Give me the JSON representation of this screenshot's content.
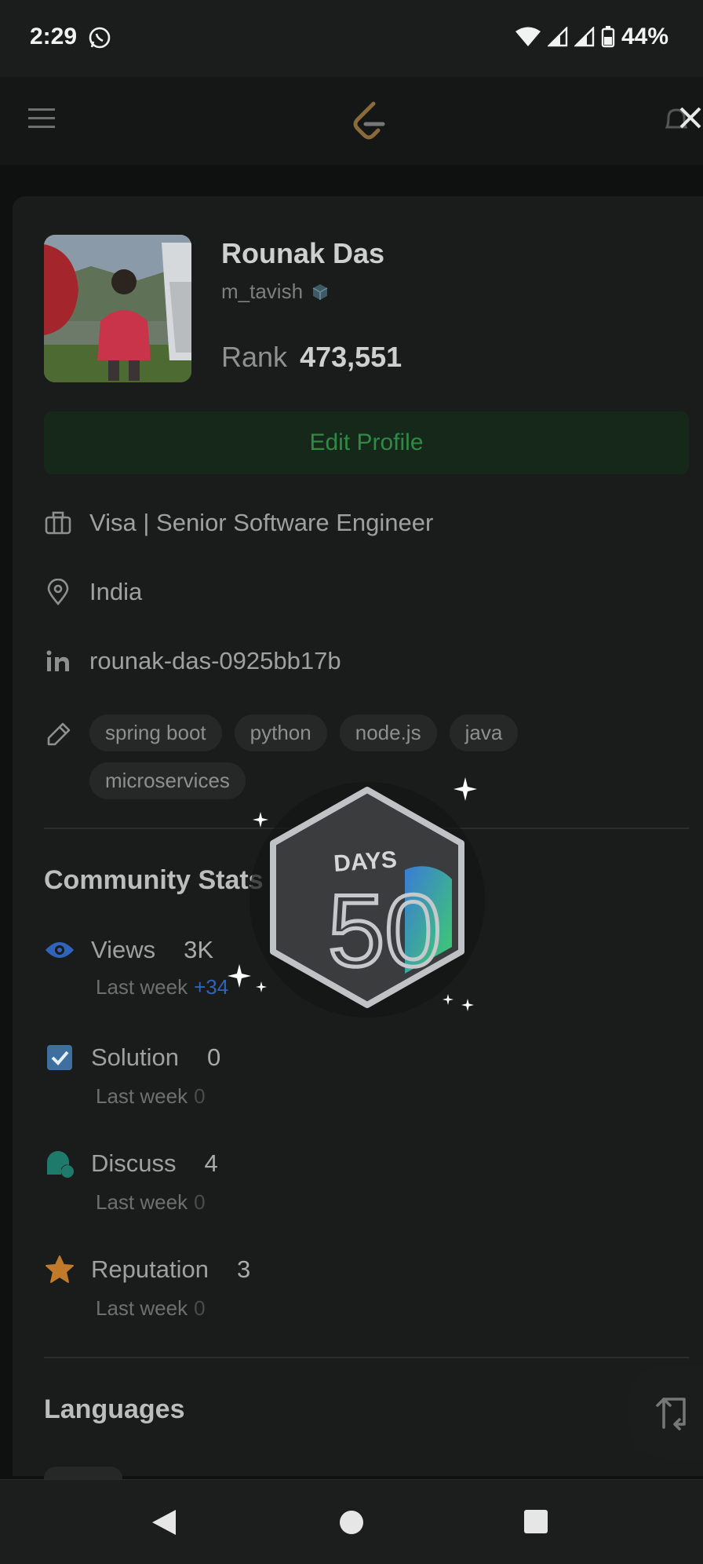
{
  "status_bar": {
    "time": "2:29",
    "battery": "44%"
  },
  "profile": {
    "name": "Rounak Das",
    "username": "m_tavish",
    "rank_label": "Rank",
    "rank_value": "473,551",
    "edit_button": "Edit Profile",
    "job": "Visa | Senior Software Engineer",
    "location": "India",
    "linkedin": "rounak-das-0925bb17b",
    "skills": [
      "spring boot",
      "python",
      "node.js",
      "java",
      "microservices"
    ]
  },
  "community_stats": {
    "title": "Community Stats",
    "last_week_label": "Last week",
    "views": {
      "label": "Views",
      "value": "3K",
      "delta": "+34"
    },
    "solution": {
      "label": "Solution",
      "value": "0",
      "delta": "0"
    },
    "discuss": {
      "label": "Discuss",
      "value": "4",
      "delta": "0"
    },
    "reputation": {
      "label": "Reputation",
      "value": "3",
      "delta": "0"
    }
  },
  "languages": {
    "title": "Languages"
  },
  "badge": {
    "text": "DAYS",
    "number": "50"
  },
  "colors": {
    "accent_green": "#2f8a43",
    "views_blue": "#2f64b8",
    "discuss_teal": "#1e7a6a",
    "reputation_orange": "#c07a2a"
  }
}
